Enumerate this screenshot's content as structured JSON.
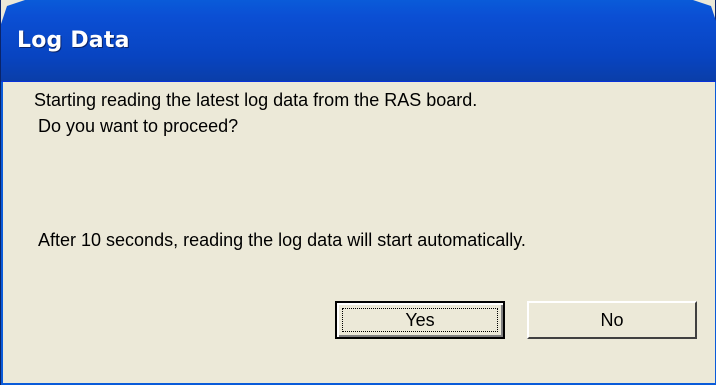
{
  "window": {
    "title": "Log Data"
  },
  "message": {
    "line1": "Starting reading the latest log data from the RAS board.",
    "line2": "Do you want to proceed?",
    "line3": "After 10 seconds, reading the log data will start automatically."
  },
  "buttons": {
    "yes_label": "Yes",
    "no_label": "No"
  },
  "colors": {
    "title_bar": "#0a4fd4",
    "dialog_face": "#ece9d8",
    "title_text": "#ffffff"
  }
}
